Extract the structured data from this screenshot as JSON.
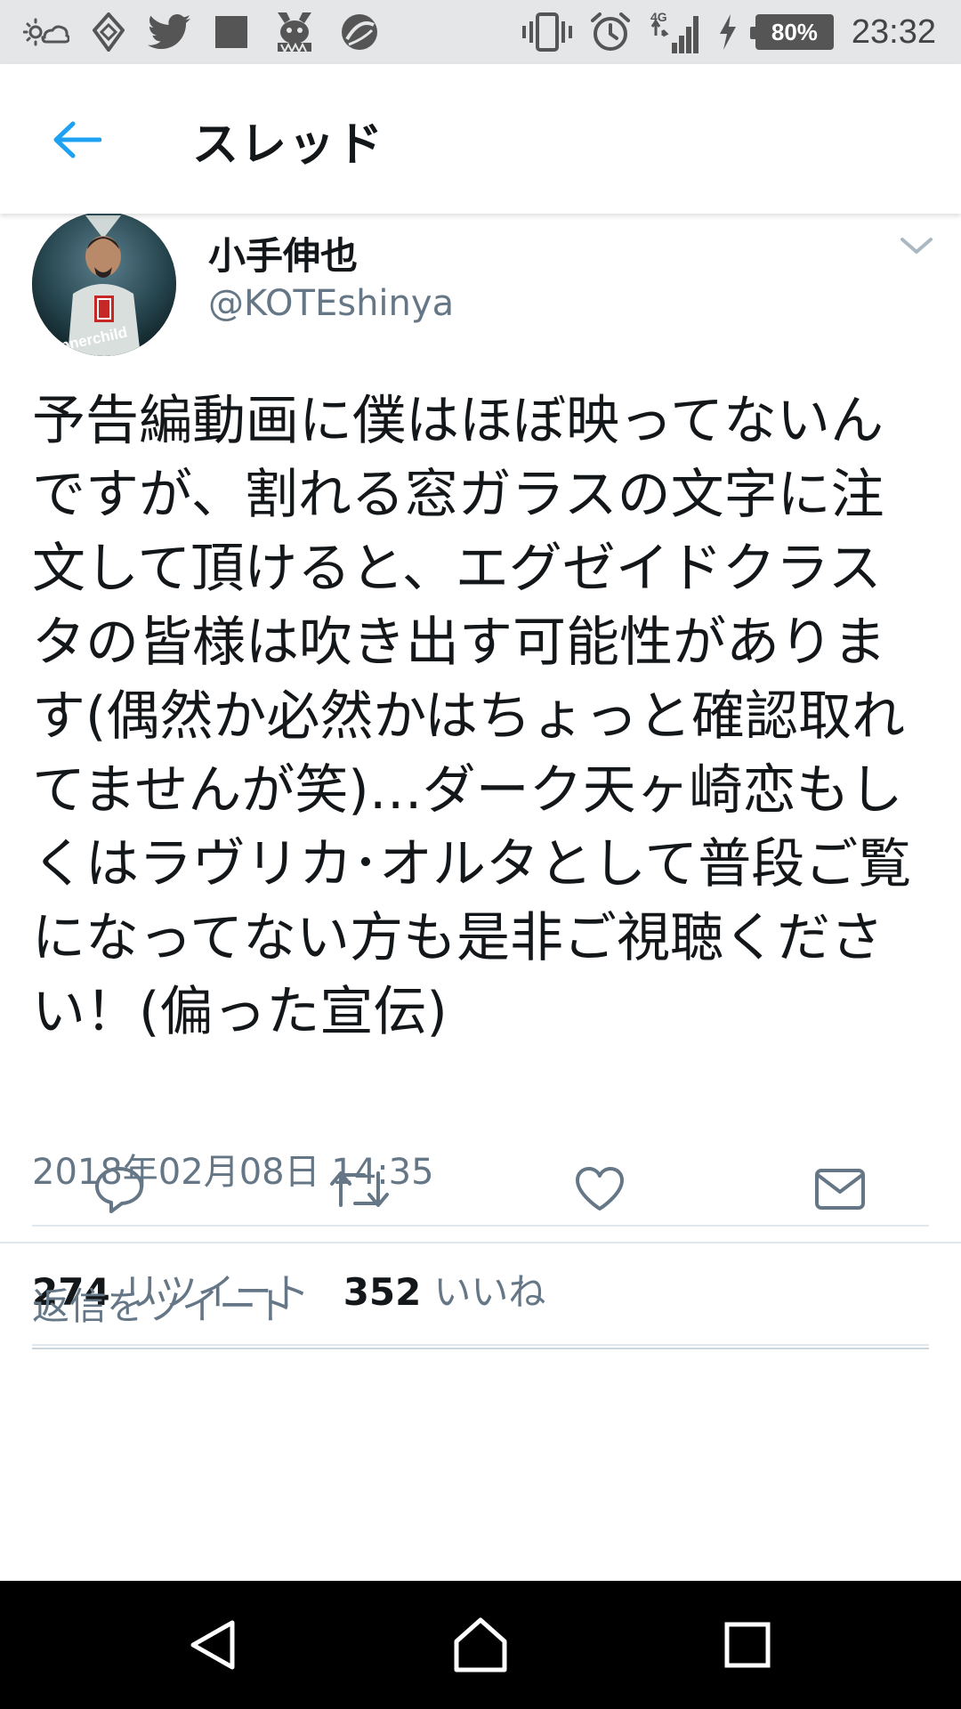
{
  "status_bar": {
    "left_icons": [
      "weather-icon",
      "feedly-icon",
      "twitter-icon",
      "app-square-icon",
      "character-app-icon",
      "sphere-app-icon"
    ],
    "right_icons": [
      "vibrate-icon",
      "alarm-icon",
      "signal-4g-icon",
      "charging-icon"
    ],
    "network": "4G",
    "battery": "80%",
    "time": "23:32"
  },
  "header": {
    "back_icon": "arrow-left-icon",
    "title": "スレッド"
  },
  "tweet": {
    "author": {
      "name": "小手伸也",
      "handle": "@KOTEshinya",
      "avatar_text": "innerchild"
    },
    "menu_icon": "chevron-down-icon",
    "text": "予告編動画に僕はほぼ映ってないんですが、割れる窓ガラスの文字に注文して頂けると、エグゼイドクラスタの皆様は吹き出す可能性があります(偶然か必然かはちょっと確認取れてませんが笑)…ダーク天ヶ崎恋もしくはラヴリカ･オルタとして普段ご覧になってない方も是非ご視聴ください！(偏った宣伝)",
    "timestamp": "2018年02月08日 14:35",
    "stats": {
      "retweet_count": "274",
      "retweet_label": "リツイート",
      "like_count": "352",
      "like_label": "いいね"
    },
    "actions": [
      "reply-icon",
      "retweet-icon",
      "like-icon",
      "direct-message-icon"
    ]
  },
  "reply": {
    "placeholder": "返信をツイート"
  },
  "nav": {
    "buttons": [
      "back-triangle-icon",
      "home-icon",
      "recents-icon"
    ]
  },
  "colors": {
    "accent": "#1da1f2",
    "primary_text": "#14171a",
    "secondary_text": "#657786",
    "divider": "#e1e8ed",
    "status_bar_bg": "#e4e6e8",
    "nav_bar_bg": "#000000"
  }
}
